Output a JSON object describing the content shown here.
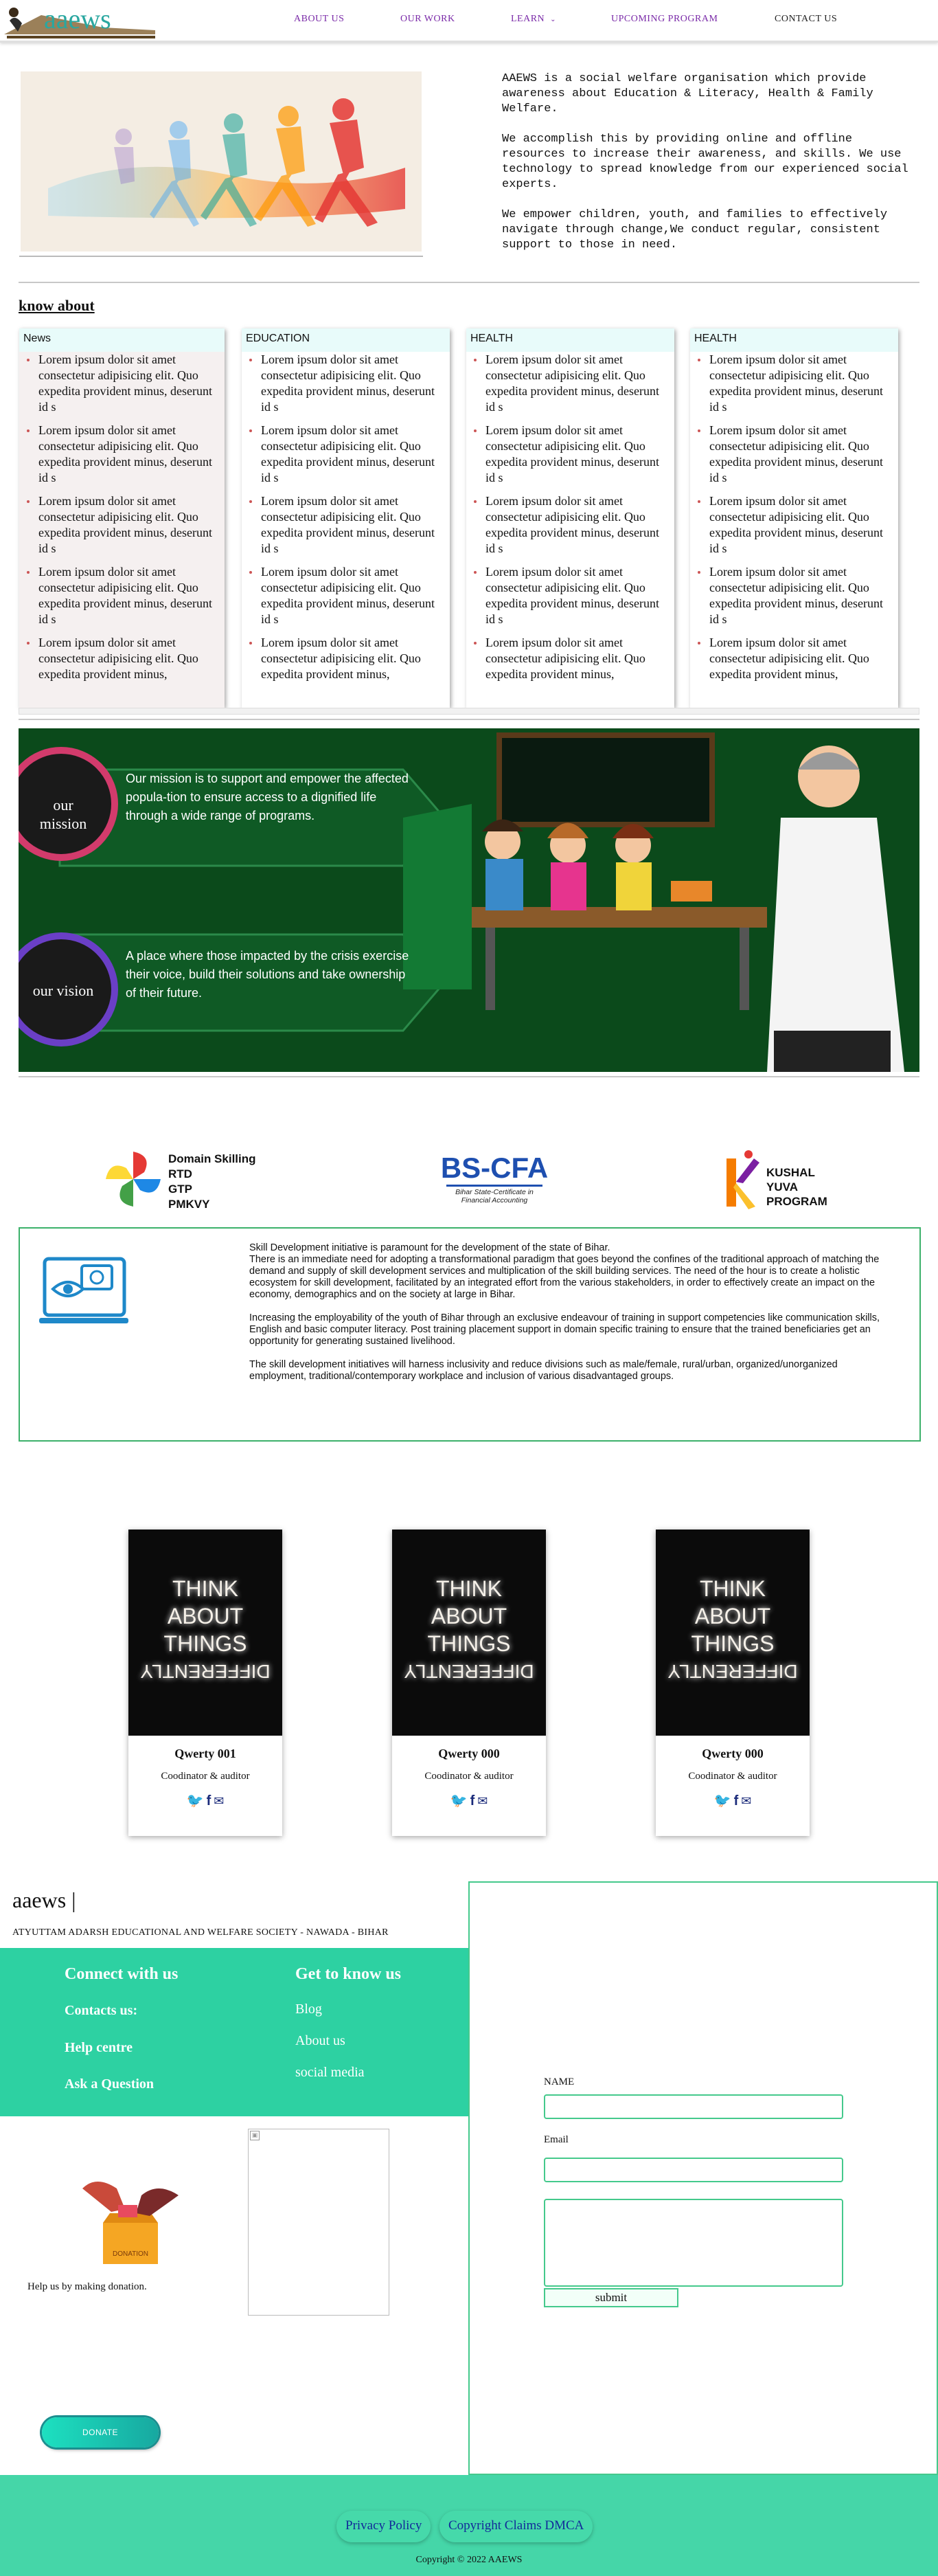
{
  "nav": {
    "logo_text": "aaews",
    "items": [
      "ABOUT US",
      "OUR WORK",
      "LEARN",
      "UPCOMING PROGRAM",
      "CONTACT US"
    ]
  },
  "intro": {
    "p1": "AAEWS is a social welfare organisation which provide awareness about Education & Literacy, Health & Family Welfare.",
    "p2": "We accomplish this by providing online and offline resources to increase their awareness, and skills. We use technology to spread knowledge from our experienced social experts.",
    "p3": "We empower children, youth, and families to effectively navigate through change,We conduct regular, consistent support to those in need."
  },
  "know_about": {
    "title": "know about",
    "columns": [
      {
        "head": "News",
        "items": [
          "Lorem ipsum dolor sit amet consectetur adipisicing elit. Quo expedita provident minus, deserunt id s",
          "Lorem ipsum dolor sit amet consectetur adipisicing elit. Quo expedita provident minus, deserunt id s",
          "Lorem ipsum dolor sit amet consectetur adipisicing elit. Quo expedita provident minus, deserunt id s",
          "Lorem ipsum dolor sit amet consectetur adipisicing elit. Quo expedita provident minus, deserunt id s",
          "Lorem ipsum dolor sit amet consectetur adipisicing elit. Quo expedita provident minus,"
        ]
      },
      {
        "head": "EDUCATION",
        "items": [
          "Lorem ipsum dolor sit amet consectetur adipisicing elit. Quo expedita provident minus, deserunt id s",
          "Lorem ipsum dolor sit amet consectetur adipisicing elit. Quo expedita provident minus, deserunt id s",
          "Lorem ipsum dolor sit amet consectetur adipisicing elit. Quo expedita provident minus, deserunt id s",
          "Lorem ipsum dolor sit amet consectetur adipisicing elit. Quo expedita provident minus, deserunt id s",
          "Lorem ipsum dolor sit amet consectetur adipisicing elit. Quo expedita provident minus,"
        ]
      },
      {
        "head": "HEALTH",
        "items": [
          "Lorem ipsum dolor sit amet consectetur adipisicing elit. Quo expedita provident minus, deserunt id s",
          "Lorem ipsum dolor sit amet consectetur adipisicing elit. Quo expedita provident minus, deserunt id s",
          "Lorem ipsum dolor sit amet consectetur adipisicing elit. Quo expedita provident minus, deserunt id s",
          "Lorem ipsum dolor sit amet consectetur adipisicing elit. Quo expedita provident minus, deserunt id s",
          "Lorem ipsum dolor sit amet consectetur adipisicing elit. Quo expedita provident minus,"
        ]
      },
      {
        "head": "HEALTH",
        "items": [
          "Lorem ipsum dolor sit amet consectetur adipisicing elit. Quo expedita provident minus, deserunt id s",
          "Lorem ipsum dolor sit amet consectetur adipisicing elit. Quo expedita provident minus, deserunt id s",
          "Lorem ipsum dolor sit amet consectetur adipisicing elit. Quo expedita provident minus, deserunt id s",
          "Lorem ipsum dolor sit amet consectetur adipisicing elit. Quo expedita provident minus, deserunt id s",
          "Lorem ipsum dolor sit amet consectetur adipisicing elit. Quo expedita provident minus,"
        ]
      }
    ]
  },
  "mission": {
    "mission_label": "our mission",
    "mission_text": "Our mission is to support and empower the affected popula-tion to ensure access to a dignified life through a wide range of programs.",
    "vision_label": "our vision",
    "vision_text": "A place where those impacted by the crisis exercise their voice, build their solutions and take ownership of their future."
  },
  "partners": {
    "domain_skilling": [
      "Domain Skilling",
      "RTD",
      "GTP",
      "PMKVY"
    ],
    "bscfa_title": "BS-CFA",
    "bscfa_sub1": "Bihar State-Certificate in",
    "bscfa_sub2": "Financial Accounting",
    "kushal": [
      "KUSHAL",
      "YUVA",
      "PROGRAM"
    ]
  },
  "skill": {
    "p1a": "Skill Development initiative is paramount for the development of the state of Bihar.",
    "p1b": "There is an immediate need for adopting a transformational paradigm that goes beyond the confines of the traditional approach of matching the",
    "p1c": "demand and supply of skill development services and multiplication of the skill building services. The need of the hour is to create a holistic ecosystem for skill development, facilitated by an integrated effort from the various stakeholders, in order to effectively create an impact on the economy, demographics and on the society at large in Bihar.",
    "p2": "Increasing the employability of the youth of Bihar through an exclusive endeavour of training in support competencies like communication skills, English and basic computer literacy. Post training placement support in domain specific training to ensure that the trained beneficiaries get an opportunity for generating sustained livelihood.",
    "p3": "The skill development initiatives will harness inclusivity and reduce divisions such as male/female, rural/urban, organized/unorganized employment, traditional/contemporary workplace and inclusion of various disadvantaged groups."
  },
  "team": {
    "poster_lines": [
      "THINK",
      "ABOUT",
      "THINGS",
      "DIFFERENTLY"
    ],
    "members": [
      {
        "name": "Qwerty 001",
        "role": "Coodinator & auditor"
      },
      {
        "name": "Qwerty 000",
        "role": "Coodinator & auditor"
      },
      {
        "name": "Qwerty 000",
        "role": "Coodinator & auditor"
      }
    ]
  },
  "footer_top": {
    "brand": "aaews |",
    "society": "ATYUTTAM ADARSH EDUCATIONAL AND WELFARE SOCIETY - NAWADA - BIHAR",
    "connect_head": "Connect with us",
    "connect_links": [
      "Contacts us:",
      "Help centre",
      "Ask a Question"
    ],
    "know_head": "Get to know us",
    "know_links": [
      "Blog",
      "About us",
      "social media"
    ],
    "donation_text": "Help us by making donation.",
    "donation_box_label": "DONATION",
    "donate_button": "DONATE"
  },
  "form": {
    "name_label": "NAME",
    "email_label": "Email",
    "submit_label": "submit"
  },
  "footer": {
    "links": [
      "Privacy Policy",
      "Copyright Claims DMCA"
    ],
    "copyright": "Copyright © 2022 AAEWS"
  },
  "colors": {
    "brand_teal": "#2aa7a0",
    "nav_purple": "#7a2aa8",
    "footer_green": "#45d6a8",
    "band_green": "#2dd1a2"
  }
}
